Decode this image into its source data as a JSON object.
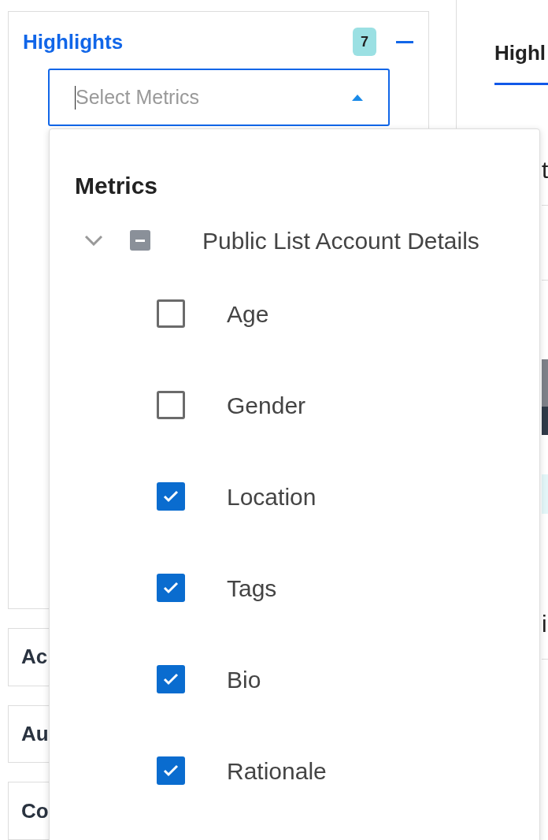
{
  "panel": {
    "title": "Highlights",
    "count": "7",
    "expanded": true,
    "select": {
      "placeholder": "Select Metrics",
      "open": true
    }
  },
  "sections": [
    {
      "label": "Ac"
    },
    {
      "label": "Au"
    },
    {
      "label": "Co"
    }
  ],
  "right": {
    "tab": {
      "label": "Highl",
      "selected": true
    },
    "fragments": [
      {
        "kind": "line",
        "text": "t"
      },
      {
        "kind": "divider"
      },
      {
        "kind": "divider"
      },
      {
        "kind": "picture"
      },
      {
        "kind": "band"
      },
      {
        "kind": "line",
        "text": "i"
      },
      {
        "kind": "divider"
      }
    ]
  },
  "dropdown": {
    "title": "Metrics",
    "group": {
      "label": "Public List Account Details",
      "expanded": true,
      "indeterminate": true,
      "children": [
        {
          "label": "Age",
          "checked": false
        },
        {
          "label": "Gender",
          "checked": false
        },
        {
          "label": "Location",
          "checked": true
        },
        {
          "label": "Tags",
          "checked": true
        },
        {
          "label": "Bio",
          "checked": true
        },
        {
          "label": "Rationale",
          "checked": true
        }
      ]
    }
  }
}
